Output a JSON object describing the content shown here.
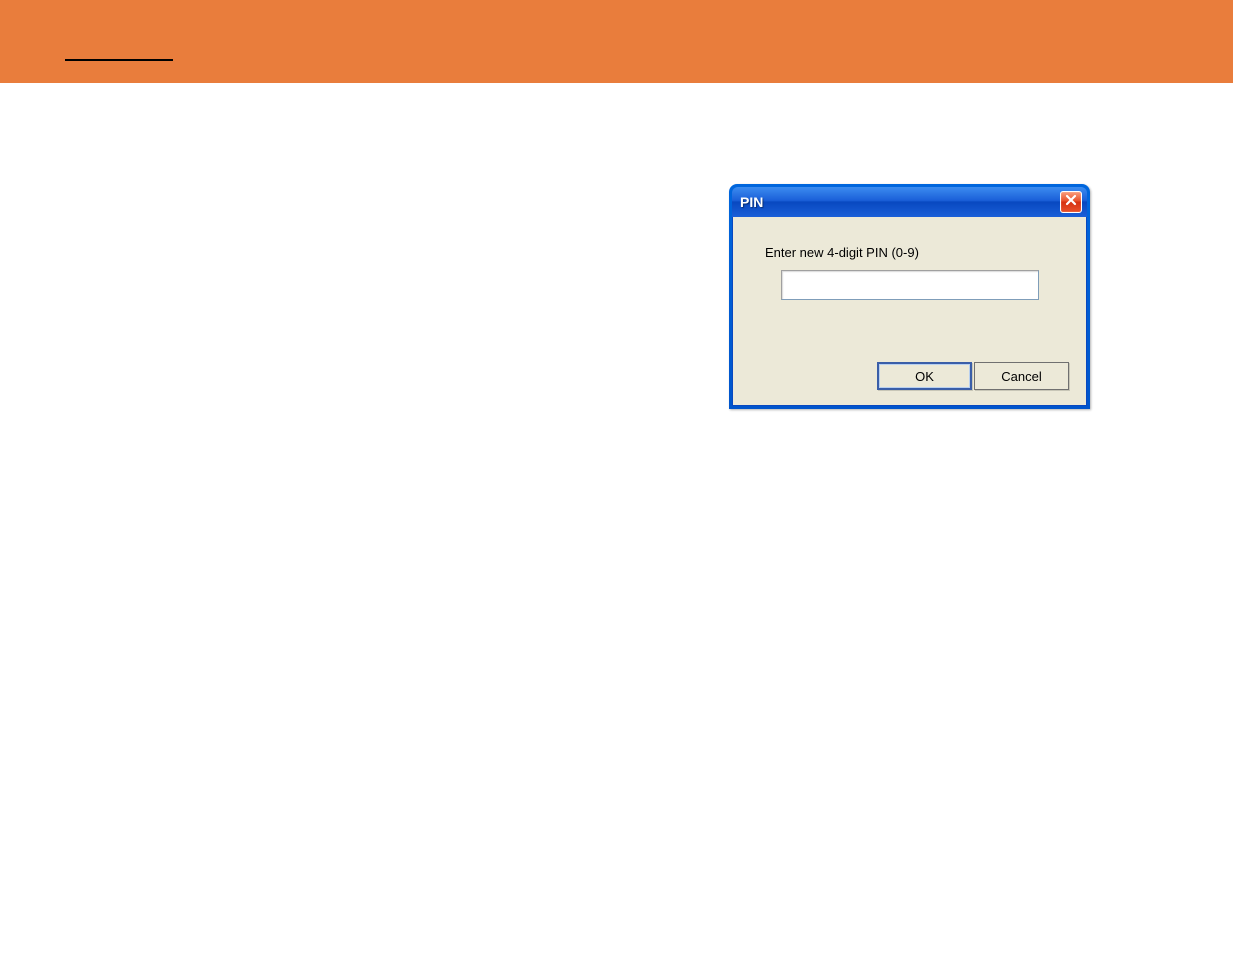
{
  "banner": {},
  "dialog": {
    "title": "PIN",
    "prompt": "Enter new 4-digit PIN (0-9)",
    "input_value": "",
    "ok_label": "OK",
    "cancel_label": "Cancel"
  }
}
